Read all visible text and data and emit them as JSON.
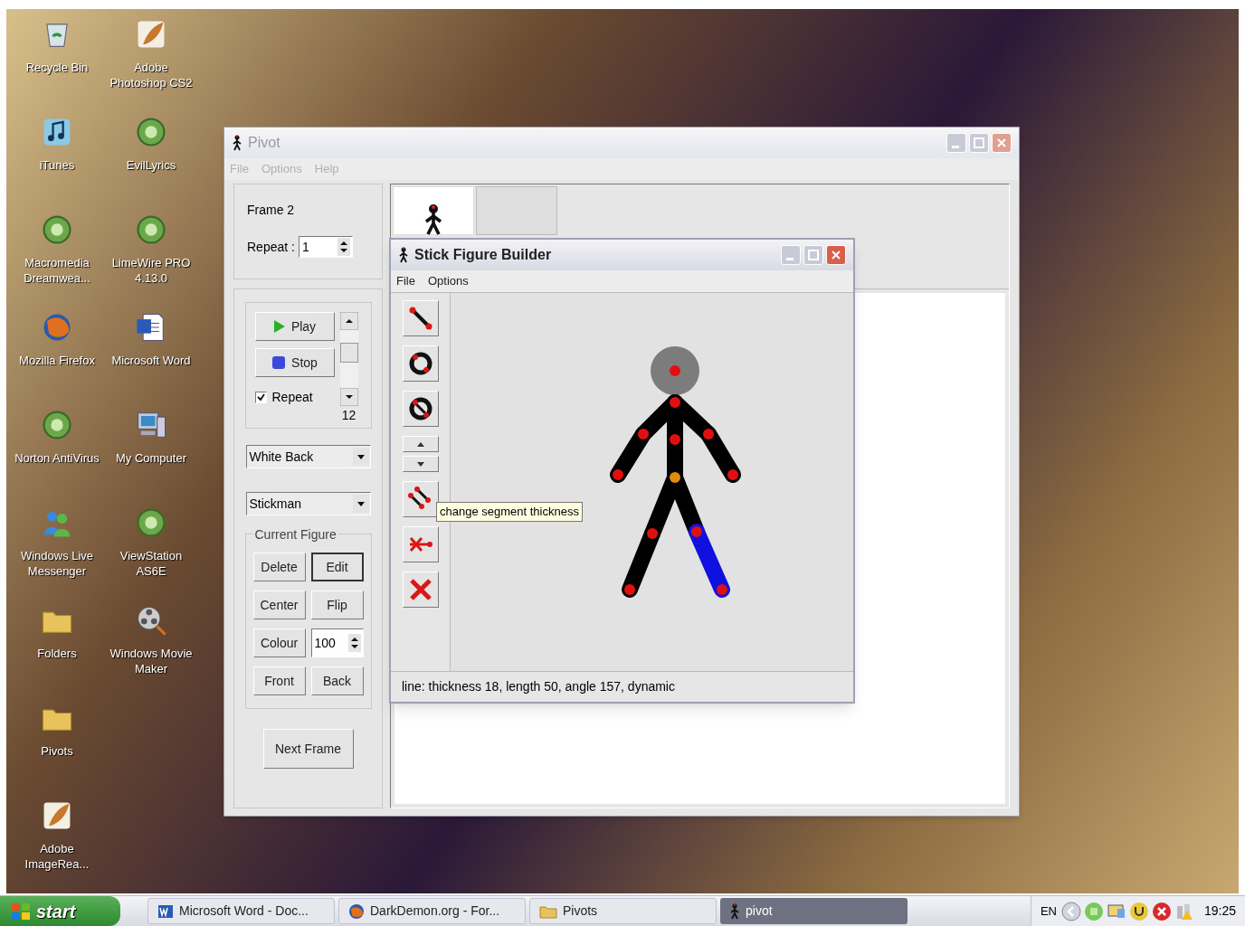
{
  "desktop_icons": [
    [
      {
        "label": "Recycle Bin",
        "kind": "recycle"
      },
      {
        "label": "iTunes",
        "kind": "music"
      },
      {
        "label": "Macromedia Dreamwea...",
        "kind": "program"
      },
      {
        "label": "Mozilla Firefox",
        "kind": "globe"
      },
      {
        "label": "Norton AntiVirus",
        "kind": "program"
      },
      {
        "label": "Windows Live Messenger",
        "kind": "people"
      },
      {
        "label": "Folders",
        "kind": "folder"
      },
      {
        "label": "Pivots",
        "kind": "folder"
      },
      {
        "label": "Adobe ImageRea...",
        "kind": "feather"
      }
    ],
    [
      {
        "label": "Adobe Photoshop CS2",
        "kind": "feather"
      },
      {
        "label": "EvilLyrics",
        "kind": "program"
      },
      {
        "label": "LimeWire PRO 4.13.0",
        "kind": "program"
      },
      {
        "label": "Microsoft Word",
        "kind": "document"
      },
      {
        "label": "My Computer",
        "kind": "computer"
      },
      {
        "label": "ViewStation AS6E",
        "kind": "program"
      },
      {
        "label": "Windows Movie Maker",
        "kind": "film"
      }
    ]
  ],
  "pivot_window": {
    "title": "Pivot",
    "active": false,
    "menu": [
      "File",
      "Options",
      "Help"
    ],
    "frame_label": "Frame 2",
    "repeat": {
      "label": "Repeat :",
      "value": "1"
    },
    "play_button": "Play",
    "stop_button": "Stop",
    "repeat_checkbox": {
      "label": "Repeat",
      "checked": true
    },
    "speed": {
      "reading": "12"
    },
    "background_select": "White Back",
    "figure_select": "Stickman",
    "current_figure": {
      "title": "Current Figure",
      "buttons": [
        {
          "label": "Delete",
          "default": false
        },
        {
          "label": "Edit",
          "default": true
        },
        {
          "label": "Center",
          "default": false
        },
        {
          "label": "Flip",
          "default": false
        },
        {
          "label": "Colour",
          "default": false
        }
      ],
      "opacity_value": "100",
      "order_buttons": [
        "Front",
        "Back"
      ]
    },
    "next_frame_button": "Next Frame",
    "frames": [
      {
        "selected": false,
        "thumbnail": true
      },
      {
        "selected": true,
        "thumbnail": false
      }
    ]
  },
  "builder_window": {
    "title": "Stick Figure Builder",
    "active": true,
    "menu": [
      "File",
      "Options"
    ],
    "tools": [
      {
        "kind": "line"
      },
      {
        "kind": "circle"
      },
      {
        "kind": "split-circle"
      },
      {
        "kind": "thickness"
      },
      {
        "kind": "double-line"
      },
      {
        "kind": "detach"
      },
      {
        "kind": "delete"
      }
    ],
    "tooltip": "change segment thickness",
    "status": "line: thickness 18, length 50, angle 157, dynamic"
  },
  "taskbar": {
    "start": "start",
    "tasks": [
      {
        "label": "Microsoft Word - Doc...",
        "kind": "word",
        "selected": false
      },
      {
        "label": "DarkDemon.org - For...",
        "kind": "browser",
        "selected": false
      },
      {
        "label": "Pivots",
        "kind": "folder",
        "selected": false
      },
      {
        "label": "pivot",
        "kind": "pivot",
        "selected": true
      }
    ],
    "language": "EN",
    "clock": "19:25"
  }
}
